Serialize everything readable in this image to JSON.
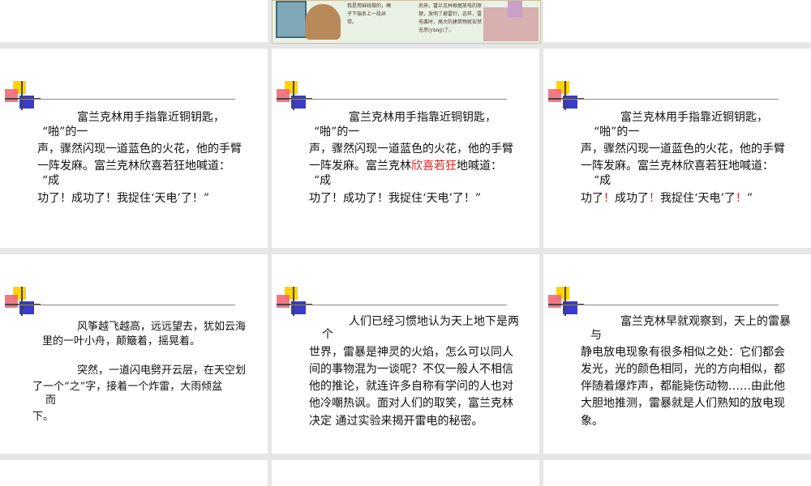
{
  "illustration": {
    "left_caption": "我是用麻线做的，绳子下端系上一段丝带。",
    "right_caption": "后来，富兰克林根据放电的原理，发明了避雷针，这样，雷电袭时，高大的建筑物就安然无恙(yàng)了。"
  },
  "slides": [
    {
      "lines": [
        "富兰克林用手指靠近铜钥匙，",
        "“啪”的一",
        "声，骤然闪现一道蓝色的火花，他的手臂",
        "一阵发麻。富兰克林欣喜若狂地喊道：",
        "“成",
        "功了！成功了！我捉住‘天电’了！”"
      ]
    },
    {
      "line1": "富兰克林用手指靠近铜钥匙，",
      "line2": "“啪”的一",
      "line3": "声，骤然闪现一道蓝色的火花，他的手臂",
      "line4_pre": "一阵发麻。富兰克林",
      "line4_red": "欣喜若狂",
      "line4_post": "地喊道：",
      "line5": "“成",
      "line6": "功了！成功了！我捉住‘天电’了！”"
    },
    {
      "line1": "富兰克林用手指靠近铜钥匙，",
      "line2": "“啪”的一",
      "line3": "声，骤然闪现一道蓝色的火花，他的手臂",
      "line4": "一阵发麻。富兰克林欣喜若狂地喊道：",
      "line5": "“成",
      "line6_a": "功了",
      "line6_ex1": "！",
      "line6_b": "成功了",
      "line6_ex2": "！",
      "line6_c": "我捉住‘天电’了",
      "line6_ex3": "！",
      "line6_d": "”"
    },
    {
      "lines": [
        "风筝越飞越高，远远望去，犹如云海",
        "里的一叶小舟，颠簸着，摇晃着。",
        "",
        "突然，一道闪电劈开云层，在天空划",
        "了一个“之”字，接着一个炸雷，大雨倾盆",
        "而",
        "下。"
      ]
    },
    {
      "lines": [
        "人们已经习惯地认为天上地下是两",
        "个",
        "世界，雷暴是神灵的火焰，怎么可以同人",
        "间的事物混为一谈呢？不仅一般人不相信",
        "他的推论，就连许多自称有学问的人也对",
        "他冷嘲热讽。面对人们的取笑，富兰克林",
        "决定  通过实验来揭开雷电的秘密。"
      ]
    },
    {
      "lines": [
        "富兰克林早就观察到，天上的雷暴",
        "与",
        "静电放电现象有很多相似之处：它们都会",
        "发光，光的颜色相同，光的方向相似，都",
        "伴随着爆炸声，都能毙伤动物……由此他",
        "大胆地推测，雷暴就是人们熟知的放电现",
        "象。"
      ]
    }
  ]
}
